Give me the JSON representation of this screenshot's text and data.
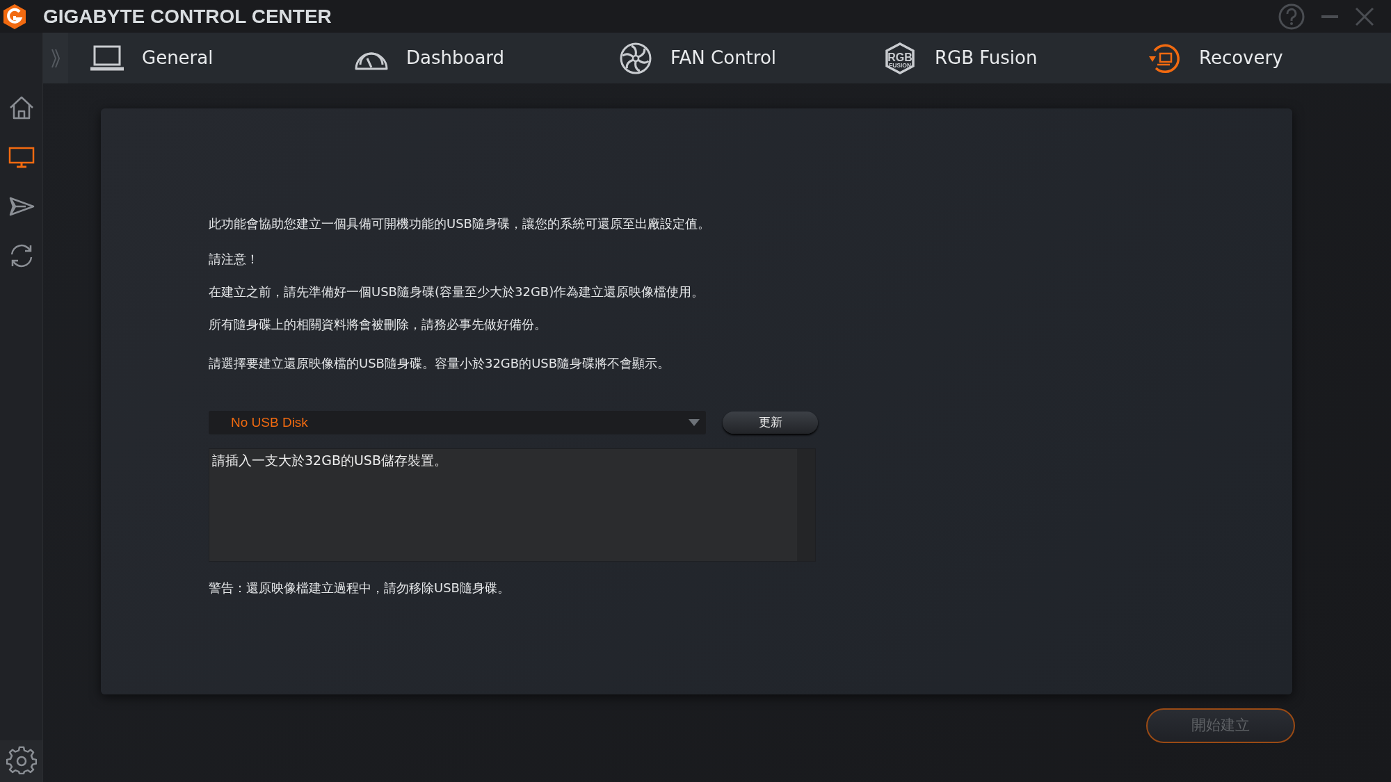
{
  "window": {
    "title": "GIGABYTE CONTROL CENTER"
  },
  "tabs": [
    {
      "label": "General",
      "kind": "laptop",
      "selected": false
    },
    {
      "label": "Dashboard",
      "kind": "gauge",
      "selected": false
    },
    {
      "label": "FAN Control",
      "kind": "fan",
      "selected": false
    },
    {
      "label": "RGB Fusion",
      "kind": "hexbadge",
      "badge_text": [
        "RGB",
        "FUSION"
      ],
      "selected": false
    },
    {
      "label": "Recovery",
      "kind": "recovery",
      "selected": true
    }
  ],
  "sidebar": {
    "items": [
      {
        "kind": "home",
        "selected": false
      },
      {
        "kind": "monitor",
        "selected": true
      },
      {
        "kind": "send",
        "selected": false
      },
      {
        "kind": "sync",
        "selected": false
      }
    ]
  },
  "paragraphs": [
    "此功能會協助您建立一個具備可開機功能的USB隨身碟，讓您的系統可還原至出廠設定值。",
    "請注意！",
    "在建立之前，請先準備好一個USB隨身碟(容量至少大於32GB)作為建立還原映像檔使用。",
    "所有隨身碟上的相關資料將會被刪除，請務必事先做好備份。"
  ],
  "select_prompt": "請選擇要建立還原映像檔的USB隨身碟。容量小於32GB的USB隨身碟將不會顯示。",
  "usb_select": {
    "value": "No USB Disk"
  },
  "refresh_button": {
    "label": "更新"
  },
  "message_box": {
    "text": "請插入一支大於32GB的USB儲存裝置。"
  },
  "warning": "警告：還原映像檔建立過程中，請勿移除USB隨身碟。",
  "start_button": {
    "label": "開始建立",
    "disabled": true
  }
}
